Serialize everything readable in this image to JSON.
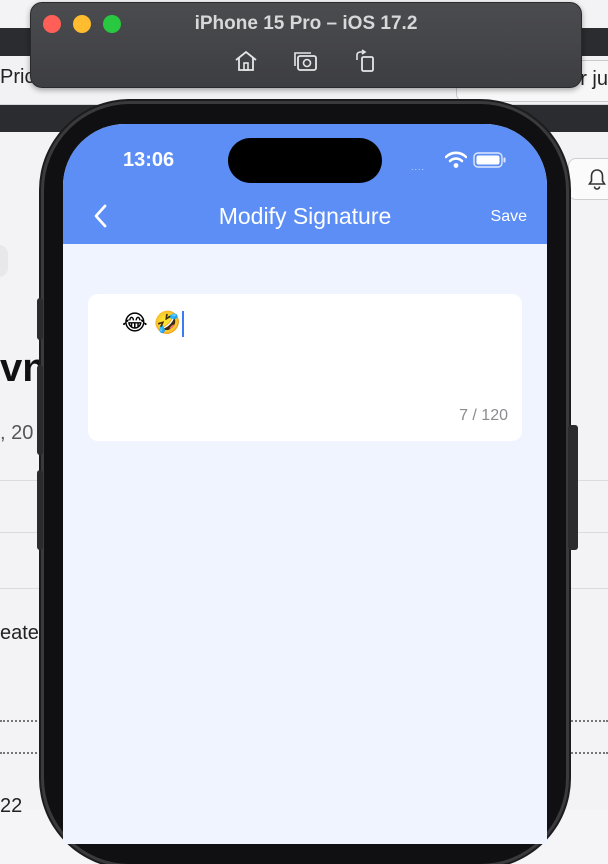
{
  "background_page": {
    "nav_left": "Pric",
    "nav_right": "r ju",
    "heading": "vn",
    "date": ", 20",
    "created": "eates",
    "bottom": "22"
  },
  "simulator": {
    "title": "iPhone 15 Pro – iOS 17.2",
    "icons": [
      "home-icon",
      "screenshot-icon",
      "rotate-icon"
    ]
  },
  "status_bar": {
    "time": "13:06",
    "signal": "....",
    "icons": [
      "wifi-icon",
      "battery-icon"
    ]
  },
  "nav_bar": {
    "title": "Modify Signature",
    "save_label": "Save",
    "back_icon": "chevron-left-icon"
  },
  "signature": {
    "text": "😂 🤣",
    "counter": "7 / 120"
  },
  "colors": {
    "header": "#5c8ef5",
    "screen_bg": "#f0f4fe",
    "caret": "#3b7bf6"
  }
}
